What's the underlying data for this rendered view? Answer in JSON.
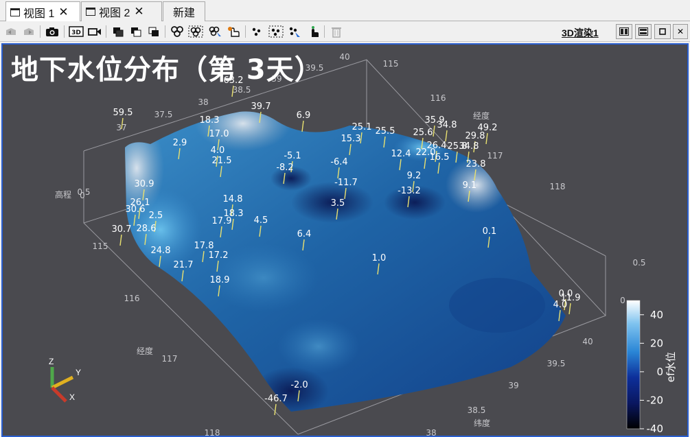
{
  "tabs": [
    {
      "label": "视图 1",
      "active": true,
      "closable": true
    },
    {
      "label": "视图 2",
      "active": false,
      "closable": true
    },
    {
      "label": "新建",
      "active": false,
      "closable": false
    }
  ],
  "toolbar": {
    "render_name": "3D渲染1",
    "icons": [
      "undo-camera-icon",
      "redo-camera-icon",
      "camera-icon",
      "3d-icon",
      "video-icon",
      "select-cells-icon",
      "select-cells-frustum-icon",
      "select-polygon-icon",
      "select-points-icon",
      "select-points-frustum-icon",
      "select-points-pick-icon",
      "interactive-select-icon",
      "select-block-icon",
      "select-block-frustum-icon",
      "select-block-pick-icon",
      "hover-icon",
      "clear-selection-icon"
    ]
  },
  "scene": {
    "title": "地下水位分布（第  3天）",
    "axes": {
      "x_title": "经度",
      "y_title": "纬度",
      "z_title": "高程",
      "x_ticks_front": [
        "115",
        "116",
        "117",
        "118"
      ],
      "y_ticks_front": [
        "38",
        "38.5",
        "39",
        "39.5",
        "40"
      ],
      "x_ticks_back": [
        "115",
        "116",
        "117",
        "118"
      ],
      "y_ticks_back": [
        "37",
        "37.5",
        "38",
        "38.5",
        "39",
        "39.5",
        "40"
      ],
      "z_ticks": [
        "0",
        "0.5"
      ]
    },
    "wells": [
      {
        "v": "63.2"
      },
      {
        "v": "59.5"
      },
      {
        "v": "39.7"
      },
      {
        "v": "18.3"
      },
      {
        "v": "6.9"
      },
      {
        "v": "17.0"
      },
      {
        "v": "2.9"
      },
      {
        "v": "4.0"
      },
      {
        "v": "21.5"
      },
      {
        "v": "-5.1"
      },
      {
        "v": "-8.2"
      },
      {
        "v": "25.1"
      },
      {
        "v": "15.3"
      },
      {
        "v": "25.5"
      },
      {
        "v": "-6.4"
      },
      {
        "v": "35.9"
      },
      {
        "v": "34.8"
      },
      {
        "v": "25.6"
      },
      {
        "v": "29.8"
      },
      {
        "v": "49.2"
      },
      {
        "v": "26.4"
      },
      {
        "v": "25.8"
      },
      {
        "v": "34.8"
      },
      {
        "v": "12.4"
      },
      {
        "v": "22.0"
      },
      {
        "v": "16.5"
      },
      {
        "v": "23.8"
      },
      {
        "v": "30.9"
      },
      {
        "v": "9.2"
      },
      {
        "v": "-11.7"
      },
      {
        "v": "-13.2"
      },
      {
        "v": "9.1"
      },
      {
        "v": "26.1"
      },
      {
        "v": "14.8"
      },
      {
        "v": "30.6"
      },
      {
        "v": "2.5"
      },
      {
        "v": "18.3"
      },
      {
        "v": "17.9"
      },
      {
        "v": "3.5"
      },
      {
        "v": "30.7"
      },
      {
        "v": "28.6"
      },
      {
        "v": "4.5"
      },
      {
        "v": "6.4"
      },
      {
        "v": "0.1"
      },
      {
        "v": "24.8"
      },
      {
        "v": "17.8"
      },
      {
        "v": "17.2"
      },
      {
        "v": "1.0"
      },
      {
        "v": "21.7"
      },
      {
        "v": "18.9"
      },
      {
        "v": "0.0"
      },
      {
        "v": "11.9"
      },
      {
        "v": "4.0"
      },
      {
        "v": "-2.0"
      },
      {
        "v": "-46.7"
      }
    ],
    "colorbar": {
      "title": "ef水位",
      "ticks": [
        "40",
        "20",
        "0",
        "-20",
        "-40"
      ],
      "range": [
        -40,
        50
      ]
    },
    "orientation_axes": [
      "Z",
      "Y",
      "X"
    ]
  }
}
